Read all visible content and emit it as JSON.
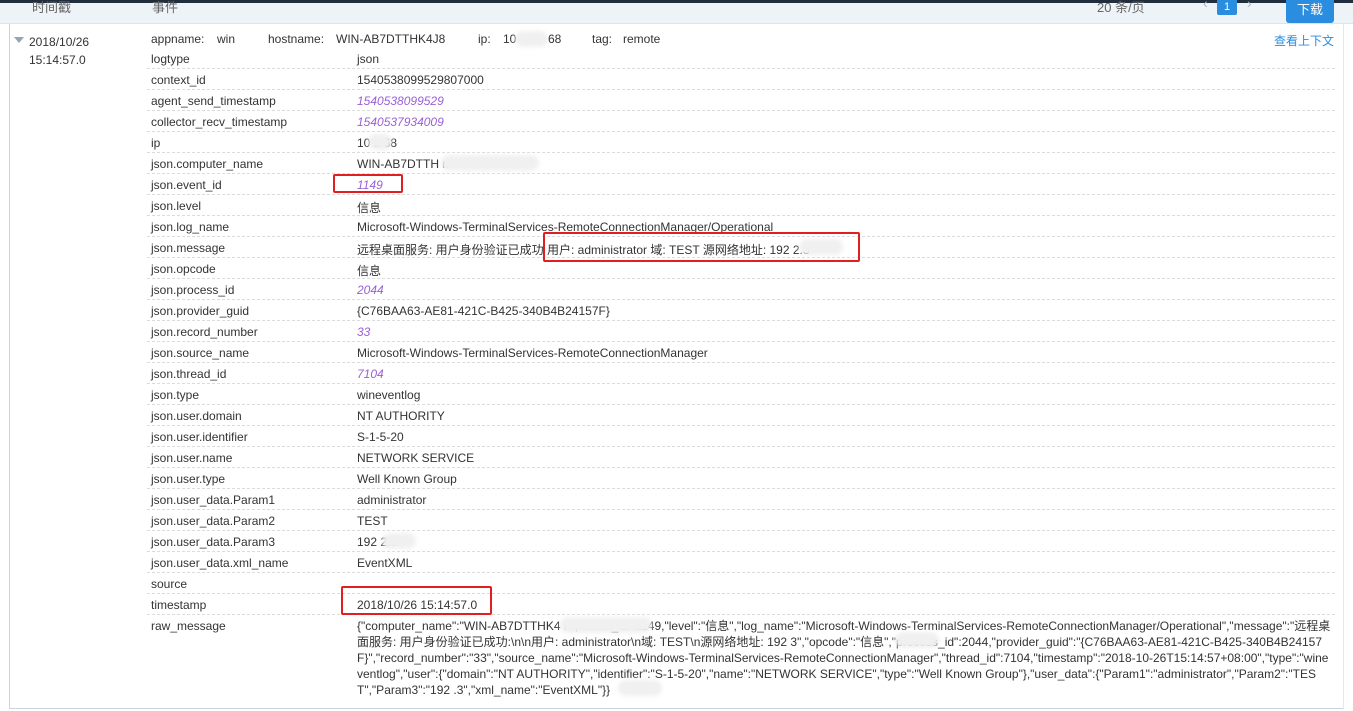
{
  "header": {
    "col_time": "时间戳",
    "col_event": "事件",
    "per_page": "20 条/页",
    "prev": "‹",
    "page": "1",
    "next": "›",
    "download": "下载"
  },
  "record": {
    "date": "2018/10/26",
    "time": "15:14:57.0",
    "summary": {
      "appname_label": "appname:",
      "appname": "win",
      "hostname_label": "hostname:",
      "hostname": "WIN-AB7DTTHK4J8",
      "ip_label": "ip:",
      "ip": "10",
      "ip_tail": "68",
      "tag_label": "tag:",
      "tag": "remote"
    },
    "context_link": "查看上下文",
    "fields": [
      {
        "key": "logtype",
        "value": "json"
      },
      {
        "key": "context_id",
        "value": "1540538099529807000"
      },
      {
        "key": "agent_send_timestamp",
        "value": "1540538099529"
      },
      {
        "key": "collector_recv_timestamp",
        "value": "1540537934009"
      },
      {
        "key": "ip",
        "value": "10      2.68"
      },
      {
        "key": "json.computer_name",
        "value": "WIN-AB7DTTH                              n"
      },
      {
        "key": "json.event_id",
        "value": "1149"
      },
      {
        "key": "json.level",
        "value": "信息"
      },
      {
        "key": "json.log_name",
        "value": "Microsoft-Windows-TerminalServices-RemoteConnectionManager/Operational"
      },
      {
        "key": "json.message",
        "value": "远程桌面服务: 用户身份验证已成功 用户: administrator 域: TEST 源网络地址: 192          2.3"
      },
      {
        "key": "json.opcode",
        "value": "信息"
      },
      {
        "key": "json.process_id",
        "value": "2044"
      },
      {
        "key": "json.provider_guid",
        "value": "{C76BAA63-AE81-421C-B425-340B4B24157F}"
      },
      {
        "key": "json.record_number",
        "value": "33"
      },
      {
        "key": "json.source_name",
        "value": "Microsoft-Windows-TerminalServices-RemoteConnectionManager"
      },
      {
        "key": "json.thread_id",
        "value": "7104"
      },
      {
        "key": "json.type",
        "value": "wineventlog"
      },
      {
        "key": "json.user.domain",
        "value": "NT AUTHORITY"
      },
      {
        "key": "json.user.identifier",
        "value": "S-1-5-20"
      },
      {
        "key": "json.user.name",
        "value": "NETWORK SERVICE"
      },
      {
        "key": "json.user.type",
        "value": "Well Known Group"
      },
      {
        "key": "json.user_data.Param1",
        "value": "administrator"
      },
      {
        "key": "json.user_data.Param2",
        "value": "TEST"
      },
      {
        "key": "json.user_data.Param3",
        "value": "192          2.3"
      },
      {
        "key": "json.user_data.xml_name",
        "value": "EventXML"
      },
      {
        "key": "source",
        "value": ""
      },
      {
        "key": "timestamp",
        "value": "2018/10/26 15:14:57.0"
      }
    ],
    "raw_key": "raw_message",
    "raw_value": "{\"computer_name\":\"WIN-AB7DTTHK4                n\",\"event_id\":1149,\"level\":\"信息\",\"log_name\":\"Microsoft-Windows-TerminalServices-RemoteConnectionManager/Operational\",\"message\":\"远程桌面服务: 用户身份验证已成功:\\n\\n用户: administrator\\n域: TEST\\n源网络地址: 192          3\",\"opcode\":\"信息\",\"process_id\":2044,\"provider_guid\":\"{C76BAA63-AE81-421C-B425-340B4B24157F}\",\"record_number\":\"33\",\"source_name\":\"Microsoft-Windows-TerminalServices-RemoteConnectionManager\",\"thread_id\":7104,\"timestamp\":\"2018-10-26T15:14:57+08:00\",\"type\":\"wineventlog\",\"user\":{\"domain\":\"NT AUTHORITY\",\"identifier\":\"S-1-5-20\",\"name\":\"NETWORK SERVICE\",\"type\":\"Well Known Group\"},\"user_data\":{\"Param1\":\"administrator\",\"Param2\":\"TEST\",\"Param3\":\"192          .3\",\"xml_name\":\"EventXML\"}}"
  },
  "colors": {
    "accent": "#2a8de0",
    "numeric": "#9a5fd6",
    "highlight": "#e02020"
  }
}
